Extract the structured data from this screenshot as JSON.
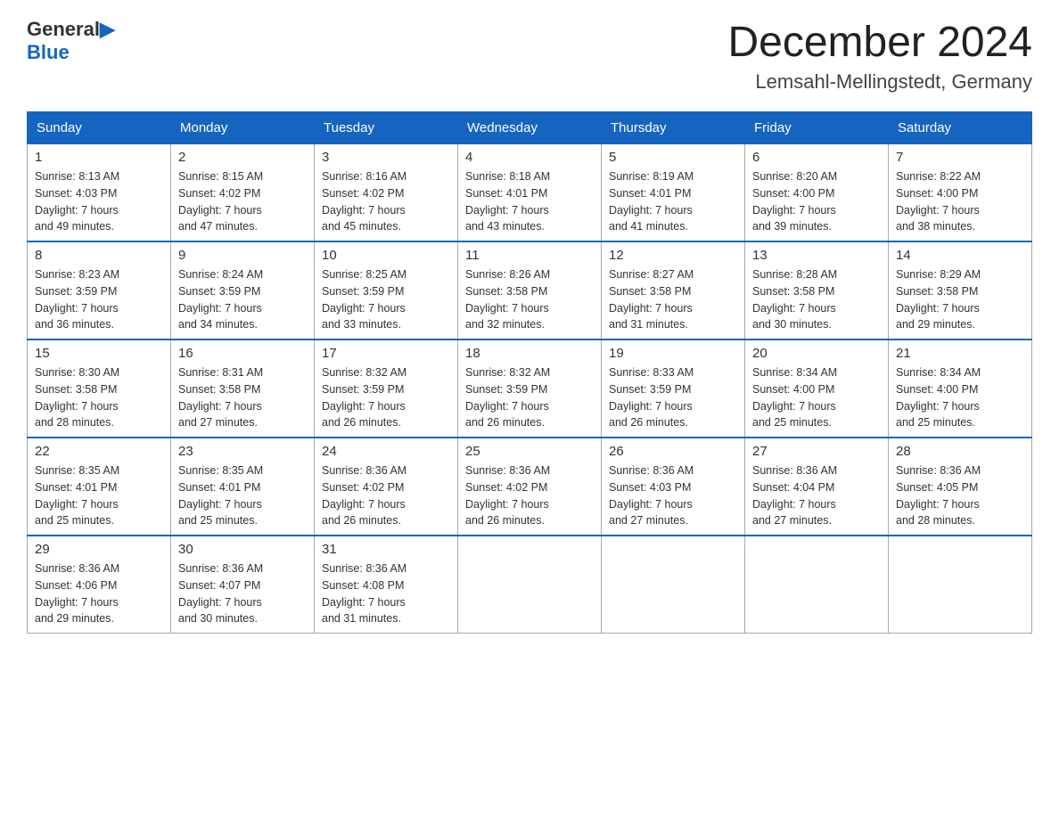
{
  "header": {
    "logo_text_general": "General",
    "logo_text_blue": "Blue",
    "month_title": "December 2024",
    "location": "Lemsahl-Mellingstedt, Germany"
  },
  "days_of_week": [
    "Sunday",
    "Monday",
    "Tuesday",
    "Wednesday",
    "Thursday",
    "Friday",
    "Saturday"
  ],
  "weeks": [
    [
      {
        "day": "1",
        "sunrise": "8:13 AM",
        "sunset": "4:03 PM",
        "daylight": "7 hours and 49 minutes."
      },
      {
        "day": "2",
        "sunrise": "8:15 AM",
        "sunset": "4:02 PM",
        "daylight": "7 hours and 47 minutes."
      },
      {
        "day": "3",
        "sunrise": "8:16 AM",
        "sunset": "4:02 PM",
        "daylight": "7 hours and 45 minutes."
      },
      {
        "day": "4",
        "sunrise": "8:18 AM",
        "sunset": "4:01 PM",
        "daylight": "7 hours and 43 minutes."
      },
      {
        "day": "5",
        "sunrise": "8:19 AM",
        "sunset": "4:01 PM",
        "daylight": "7 hours and 41 minutes."
      },
      {
        "day": "6",
        "sunrise": "8:20 AM",
        "sunset": "4:00 PM",
        "daylight": "7 hours and 39 minutes."
      },
      {
        "day": "7",
        "sunrise": "8:22 AM",
        "sunset": "4:00 PM",
        "daylight": "7 hours and 38 minutes."
      }
    ],
    [
      {
        "day": "8",
        "sunrise": "8:23 AM",
        "sunset": "3:59 PM",
        "daylight": "7 hours and 36 minutes."
      },
      {
        "day": "9",
        "sunrise": "8:24 AM",
        "sunset": "3:59 PM",
        "daylight": "7 hours and 34 minutes."
      },
      {
        "day": "10",
        "sunrise": "8:25 AM",
        "sunset": "3:59 PM",
        "daylight": "7 hours and 33 minutes."
      },
      {
        "day": "11",
        "sunrise": "8:26 AM",
        "sunset": "3:58 PM",
        "daylight": "7 hours and 32 minutes."
      },
      {
        "day": "12",
        "sunrise": "8:27 AM",
        "sunset": "3:58 PM",
        "daylight": "7 hours and 31 minutes."
      },
      {
        "day": "13",
        "sunrise": "8:28 AM",
        "sunset": "3:58 PM",
        "daylight": "7 hours and 30 minutes."
      },
      {
        "day": "14",
        "sunrise": "8:29 AM",
        "sunset": "3:58 PM",
        "daylight": "7 hours and 29 minutes."
      }
    ],
    [
      {
        "day": "15",
        "sunrise": "8:30 AM",
        "sunset": "3:58 PM",
        "daylight": "7 hours and 28 minutes."
      },
      {
        "day": "16",
        "sunrise": "8:31 AM",
        "sunset": "3:58 PM",
        "daylight": "7 hours and 27 minutes."
      },
      {
        "day": "17",
        "sunrise": "8:32 AM",
        "sunset": "3:59 PM",
        "daylight": "7 hours and 26 minutes."
      },
      {
        "day": "18",
        "sunrise": "8:32 AM",
        "sunset": "3:59 PM",
        "daylight": "7 hours and 26 minutes."
      },
      {
        "day": "19",
        "sunrise": "8:33 AM",
        "sunset": "3:59 PM",
        "daylight": "7 hours and 26 minutes."
      },
      {
        "day": "20",
        "sunrise": "8:34 AM",
        "sunset": "4:00 PM",
        "daylight": "7 hours and 25 minutes."
      },
      {
        "day": "21",
        "sunrise": "8:34 AM",
        "sunset": "4:00 PM",
        "daylight": "7 hours and 25 minutes."
      }
    ],
    [
      {
        "day": "22",
        "sunrise": "8:35 AM",
        "sunset": "4:01 PM",
        "daylight": "7 hours and 25 minutes."
      },
      {
        "day": "23",
        "sunrise": "8:35 AM",
        "sunset": "4:01 PM",
        "daylight": "7 hours and 25 minutes."
      },
      {
        "day": "24",
        "sunrise": "8:36 AM",
        "sunset": "4:02 PM",
        "daylight": "7 hours and 26 minutes."
      },
      {
        "day": "25",
        "sunrise": "8:36 AM",
        "sunset": "4:02 PM",
        "daylight": "7 hours and 26 minutes."
      },
      {
        "day": "26",
        "sunrise": "8:36 AM",
        "sunset": "4:03 PM",
        "daylight": "7 hours and 27 minutes."
      },
      {
        "day": "27",
        "sunrise": "8:36 AM",
        "sunset": "4:04 PM",
        "daylight": "7 hours and 27 minutes."
      },
      {
        "day": "28",
        "sunrise": "8:36 AM",
        "sunset": "4:05 PM",
        "daylight": "7 hours and 28 minutes."
      }
    ],
    [
      {
        "day": "29",
        "sunrise": "8:36 AM",
        "sunset": "4:06 PM",
        "daylight": "7 hours and 29 minutes."
      },
      {
        "day": "30",
        "sunrise": "8:36 AM",
        "sunset": "4:07 PM",
        "daylight": "7 hours and 30 minutes."
      },
      {
        "day": "31",
        "sunrise": "8:36 AM",
        "sunset": "4:08 PM",
        "daylight": "7 hours and 31 minutes."
      },
      null,
      null,
      null,
      null
    ]
  ],
  "labels": {
    "sunrise": "Sunrise:",
    "sunset": "Sunset:",
    "daylight": "Daylight:"
  }
}
